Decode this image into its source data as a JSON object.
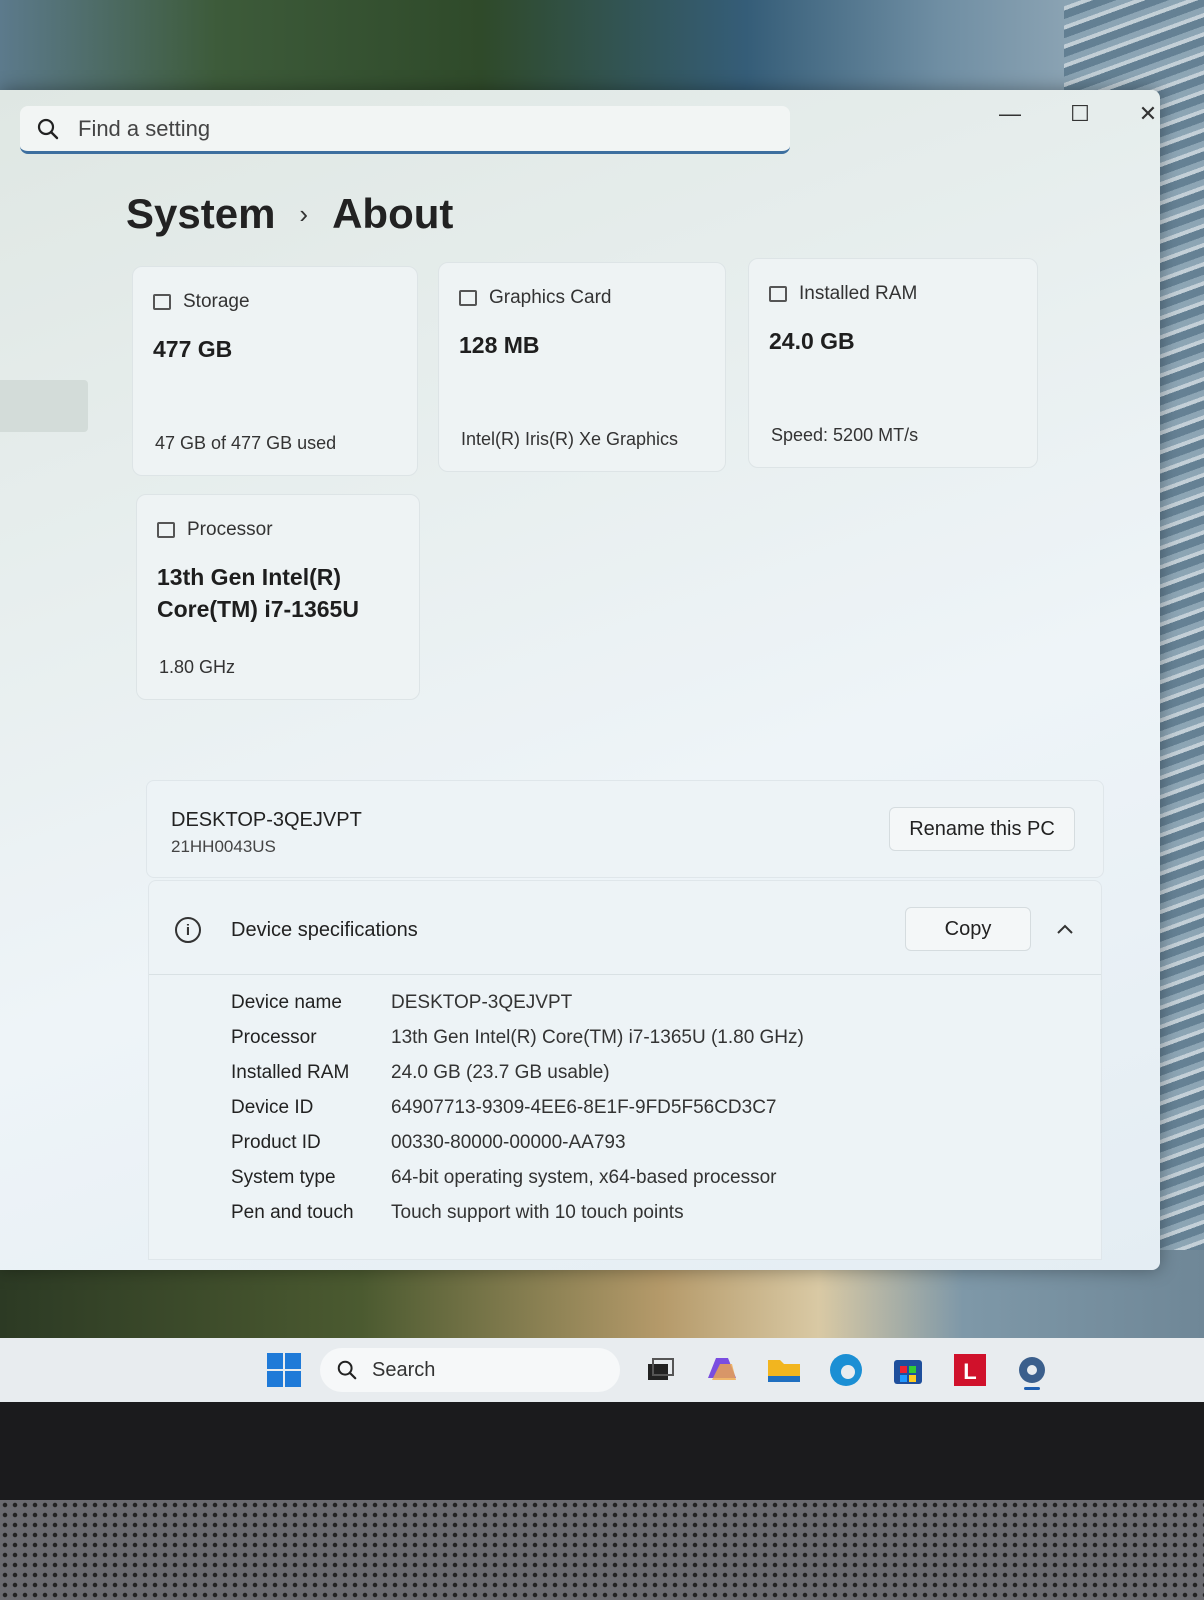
{
  "search": {
    "placeholder": "Find a setting"
  },
  "window_controls": {
    "minimize": "—",
    "maximize": "☐",
    "close": "✕"
  },
  "breadcrumb": {
    "parent": "System",
    "separator": "›",
    "current": "About"
  },
  "cards": {
    "storage": {
      "label": "Storage",
      "value": "477 GB",
      "detail": "47 GB of 477 GB used"
    },
    "graphics": {
      "label": "Graphics Card",
      "value": "128 MB",
      "detail": "Intel(R) Iris(R) Xe Graphics"
    },
    "ram": {
      "label": "Installed RAM",
      "value": "24.0 GB",
      "detail": "Speed: 5200 MT/s"
    },
    "processor": {
      "label": "Processor",
      "value_line1": "13th Gen Intel(R)",
      "value_line2": "Core(TM) i7-1365U",
      "detail": "1.80 GHz"
    }
  },
  "pc": {
    "name": "DESKTOP-3QEJVPT",
    "model": "21HH0043US",
    "rename_label": "Rename this PC"
  },
  "device_specs": {
    "title": "Device specifications",
    "copy_label": "Copy",
    "rows": [
      {
        "key": "Device name",
        "value": "DESKTOP-3QEJVPT"
      },
      {
        "key": "Processor",
        "value": "13th Gen Intel(R) Core(TM) i7-1365U (1.80 GHz)"
      },
      {
        "key": "Installed RAM",
        "value": "24.0 GB (23.7 GB usable)"
      },
      {
        "key": "Device ID",
        "value": "64907713-9309-4EE6-8E1F-9FD5F56CD3C7"
      },
      {
        "key": "Product ID",
        "value": "00330-80000-00000-AA793"
      },
      {
        "key": "System type",
        "value": "64-bit operating system, x64-based processor"
      },
      {
        "key": "Pen and touch",
        "value": "Touch support with 10 touch points"
      }
    ]
  },
  "taskbar": {
    "search_label": "Search",
    "icons": [
      "windows-start-icon",
      "task-view-icon",
      "copilot-icon",
      "file-explorer-icon",
      "edge-icon",
      "store-icon",
      "lenovo-icon",
      "settings-icon"
    ],
    "colors": {
      "start": "#1f7ad8",
      "explorer": "#f2b51f",
      "edge": "#1b8fd4",
      "store": "#1f4f9c",
      "lenovo": "#d0112b",
      "settings": "#3b5f8c"
    }
  }
}
